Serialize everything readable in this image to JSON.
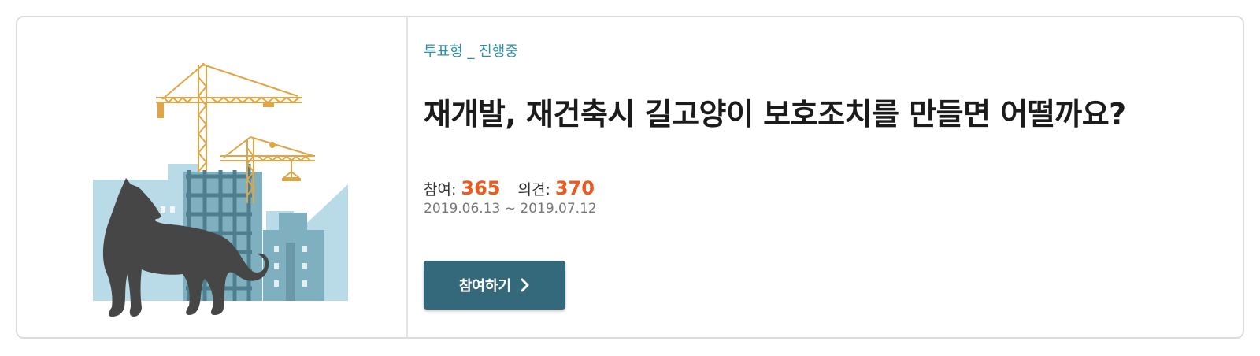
{
  "card": {
    "category": "투표형 _ 진행중",
    "title": "재개발, 재건축시 길고양이 보호조치를 만들면 어떨까요?",
    "stats": {
      "participants_label": "참여:",
      "participants_value": "365",
      "opinions_label": "의견:",
      "opinions_value": "370"
    },
    "period": "2019.06.13 ~ 2019.07.12",
    "cta_label": "참여하기",
    "cta_icon": "chevron-right-icon",
    "illustration": "cat-silhouette-construction-illustration"
  },
  "colors": {
    "category": "#2e8fa6",
    "number_accent": "#ee5a1e",
    "button_bg": "#34687b",
    "crane": "#e0a546",
    "building_light": "#b9dbe8",
    "building_mid": "#7fb0bf",
    "cat": "#464646"
  }
}
